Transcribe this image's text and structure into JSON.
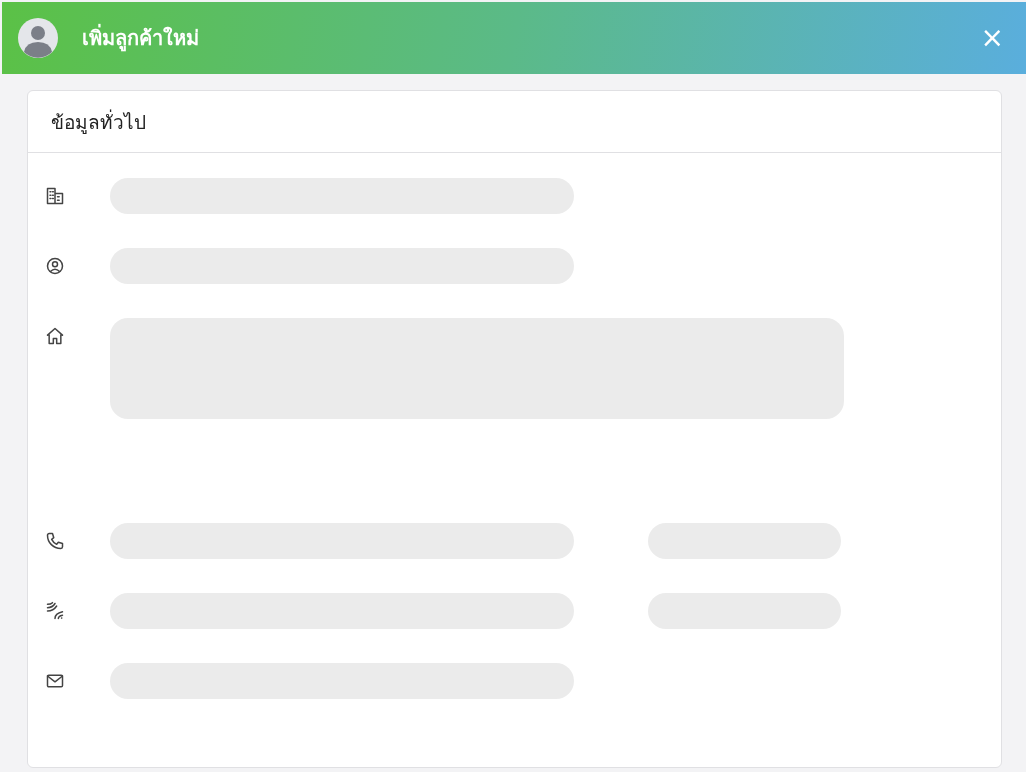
{
  "dialog": {
    "title": "เพิ่มลูกค้าใหม่",
    "close": "×"
  },
  "section": {
    "title": "ข้อมูลทั่วไป",
    "rows": [
      {
        "kind": "building",
        "fields": [
          {
            "kind": "wide"
          }
        ]
      },
      {
        "kind": "person",
        "fields": [
          {
            "kind": "wide"
          }
        ]
      },
      {
        "kind": "home",
        "fields": [
          {
            "kind": "large"
          }
        ]
      },
      {
        "kind": "phone",
        "fields": [
          {
            "kind": "wide"
          },
          {
            "kind": "narrow"
          }
        ]
      },
      {
        "kind": "fax",
        "fields": [
          {
            "kind": "wide"
          },
          {
            "kind": "narrow"
          }
        ]
      },
      {
        "kind": "mail",
        "fields": [
          {
            "kind": "wide"
          }
        ]
      }
    ]
  }
}
